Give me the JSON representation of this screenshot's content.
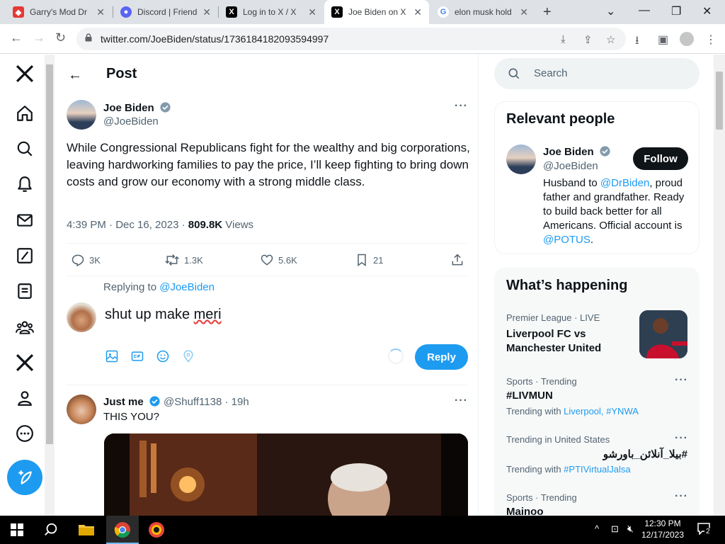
{
  "browser": {
    "tabs": [
      {
        "title": "Garry's Mod Dr",
        "favicon": "garrys-mod-icon"
      },
      {
        "title": "Discord | Friend",
        "favicon": "discord-icon"
      },
      {
        "title": "Log in to X / X",
        "favicon": "x-icon"
      },
      {
        "title": "Joe Biden on X",
        "favicon": "x-icon",
        "active": true
      },
      {
        "title": "elon musk hold",
        "favicon": "google-icon"
      }
    ],
    "url": "twitter.com/JoeBiden/status/1736184182093594997"
  },
  "page": {
    "header": {
      "title": "Post"
    },
    "tweet": {
      "author_name": "Joe Biden",
      "author_handle": "@JoeBiden",
      "text": "While Congressional Republicans fight for the wealthy and big corporations, leaving hardworking families to pay the price, I’ll keep fighting to bring down costs and grow our economy with a strong middle class.",
      "timestamp": "4:39 PM · Dec 16, 2023 · ",
      "views_count": "809.8K",
      "views_label": " Views",
      "stats": {
        "replies": "3K",
        "reposts": "1.3K",
        "likes": "5.6K",
        "bookmarks": "21"
      }
    },
    "reply_box": {
      "replying_to_label": "Replying to ",
      "replying_to_handle": "@JoeBiden",
      "text_start": "shut up make ",
      "text_misspelled": "meri",
      "reply_label": "Reply"
    },
    "reply_tweet": {
      "author_name": "Just me",
      "author_handle": "@Shuff1138",
      "sep": " · ",
      "age": "19h",
      "text": "THIS YOU?"
    }
  },
  "sidebar": {
    "search_placeholder": "Search",
    "relevant_people": {
      "title": "Relevant people",
      "name": "Joe Biden",
      "handle": "@JoeBiden",
      "follow_label": "Follow",
      "bio_1": "Husband to ",
      "bio_link_1": "@DrBiden",
      "bio_2": ", proud father and grandfather. Ready to build back better for all Americans. Official account is ",
      "bio_link_2": "@POTUS",
      "bio_3": "."
    },
    "whats_happening": {
      "title": "What’s happening",
      "items": [
        {
          "meta": "Premier League · LIVE",
          "name": "Liverpool FC vs Manchester United"
        },
        {
          "meta": "Sports · Trending",
          "name": "#LIVMUN",
          "with_label": "Trending with ",
          "with_tags": "Liverpool, #YNWA"
        },
        {
          "meta": "Trending in United States",
          "name": "#بیلا_آنلائن_باورشو",
          "with_label": "Trending with ",
          "with_tags": "#PTIVirtualJalsa"
        },
        {
          "meta": "Sports · Trending",
          "name": "Mainoo"
        }
      ]
    }
  },
  "taskbar": {
    "time": "12:30 PM",
    "date": "12/17/2023",
    "notifications": "2"
  },
  "colors": {
    "x_blue": "#1d9bf0",
    "text": "#0f1419",
    "muted": "#536471"
  }
}
